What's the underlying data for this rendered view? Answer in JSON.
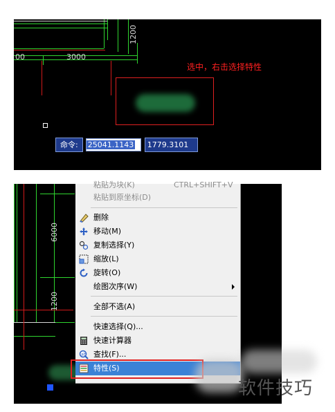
{
  "top_panel": {
    "annotation": "选中，右击选择特性",
    "dim_3000": "3000",
    "dim_1200": "1200",
    "dim_00": "00",
    "command_label": "命令:",
    "coord_x": "25041.1143",
    "coord_y": "1779.3101"
  },
  "bottom_panel": {
    "dim_6000": "6000",
    "dim_1200": "1200"
  },
  "context_menu": {
    "items": [
      {
        "label": "粘贴为块(K)",
        "shortcut": "CTRL+SHIFT+V",
        "disabled": true
      },
      {
        "label": "粘贴到原坐标(D)",
        "disabled": true
      },
      {
        "label": "删除",
        "icon": "eraser-icon"
      },
      {
        "label": "移动(M)",
        "icon": "move-icon"
      },
      {
        "label": "复制选择(Y)",
        "icon": "copy-icon"
      },
      {
        "label": "缩放(L)",
        "icon": "scale-icon"
      },
      {
        "label": "旋转(O)",
        "icon": "rotate-icon"
      },
      {
        "label": "绘图次序(W)",
        "has_submenu": true
      },
      {
        "label": "全部不选(A)"
      },
      {
        "label": "快速选择(Q)..."
      },
      {
        "label": "快速计算器",
        "icon": "calculator-icon"
      },
      {
        "label": "查找(F)...",
        "icon": "find-icon"
      },
      {
        "label": "特性(S)",
        "icon": "properties-icon",
        "highlighted": true
      }
    ]
  },
  "watermark": "软件技巧",
  "colors": {
    "canvas": "#000000",
    "drawing_lines": "#2fd52f",
    "annotation": "#ff2020",
    "menu_highlight": "#3b82d6",
    "command_bar": "#1e3a8c"
  }
}
